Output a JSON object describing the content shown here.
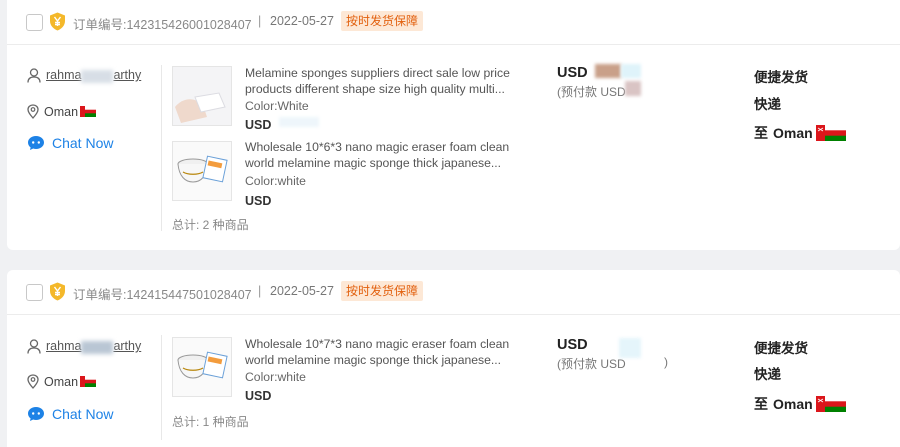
{
  "orders": [
    {
      "order_no": "订单编号:142315426001028407",
      "separator": "|",
      "date": "2022-05-27",
      "badge": "按时发货保障",
      "buyer_name_prefix": "rahma",
      "buyer_name_suffix": "arthy",
      "country": "Oman",
      "chat": "Chat Now",
      "products": [
        {
          "title": "Melamine sponges suppliers direct sale low price products different shape size high quality multi...",
          "color": "Color:White",
          "usd": "USD"
        },
        {
          "title": "Wholesale 10*6*3 nano magic eraser foam clean world melamine magic sponge thick japanese...",
          "color": "Color:white",
          "usd": "USD"
        }
      ],
      "total": "总计: 2 种商品",
      "price_usd": "USD",
      "prepay": "(预付款 USD",
      "shipping_method": "便捷发货",
      "shipping_type": "快递",
      "destination_prefix": "至",
      "destination": "Oman"
    },
    {
      "order_no": "订单编号:142415447501028407",
      "separator": "|",
      "date": "2022-05-27",
      "badge": "按时发货保障",
      "buyer_name_prefix": "rahma",
      "buyer_name_suffix": "arthy",
      "country": "Oman",
      "chat": "Chat Now",
      "products": [
        {
          "title": "Wholesale 10*7*3 nano magic eraser foam clean world melamine magic sponge thick japanese...",
          "color": "Color:white",
          "usd": "USD"
        }
      ],
      "total": "总计: 1 种商品",
      "price_usd": "USD",
      "prepay": "(预付款 USD",
      "prepay_close": ")",
      "shipping_method": "便捷发货",
      "shipping_type": "快递",
      "destination_prefix": "至",
      "destination": "Oman"
    }
  ],
  "colors": {
    "badge_text": "#e2600e",
    "badge_bg": "#fde8d6",
    "chat_blue": "#1d82e6",
    "shield_gold": "#f4b82a"
  },
  "icons": [
    "shield-icon",
    "user-icon",
    "location-icon",
    "chat-icon",
    "oman-flag"
  ]
}
